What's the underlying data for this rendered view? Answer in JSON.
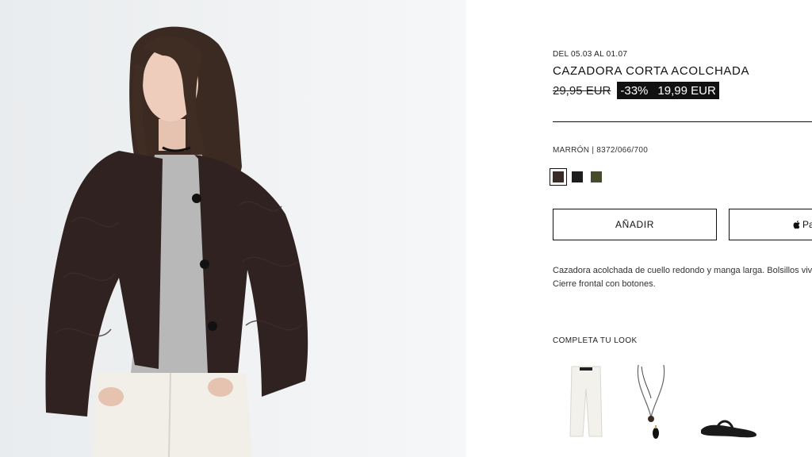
{
  "product": {
    "promo_dates": "DEL 05.03 AL 01.07",
    "title": "CAZADORA CORTA ACOLCHADA",
    "old_price": "29,95 EUR",
    "discount": "-33%",
    "new_price": "19,99 EUR",
    "color_label": "MARRÓN | 8372/066/700",
    "swatches": [
      {
        "name": "brown",
        "color": "#3a2a28",
        "selected": true
      },
      {
        "name": "black",
        "color": "#1e1e1e",
        "selected": false
      },
      {
        "name": "olive",
        "color": "#4a4a2c",
        "selected": false
      }
    ],
    "add_label": "AÑADIR",
    "pay_label": "Pay",
    "pay_icon": "apple-icon",
    "description": "Cazadora acolchada de cuello redondo y manga larga. Bolsillos vivo. Cierre frontal con botones.",
    "look_title": "COMPLETA TU LOOK",
    "look_items": [
      "white-jeans",
      "pendant-necklace",
      "black-sandal"
    ]
  },
  "colors": {
    "text": "#111111",
    "jacket": "#2f2220",
    "background_photo": "#eef0f1"
  }
}
